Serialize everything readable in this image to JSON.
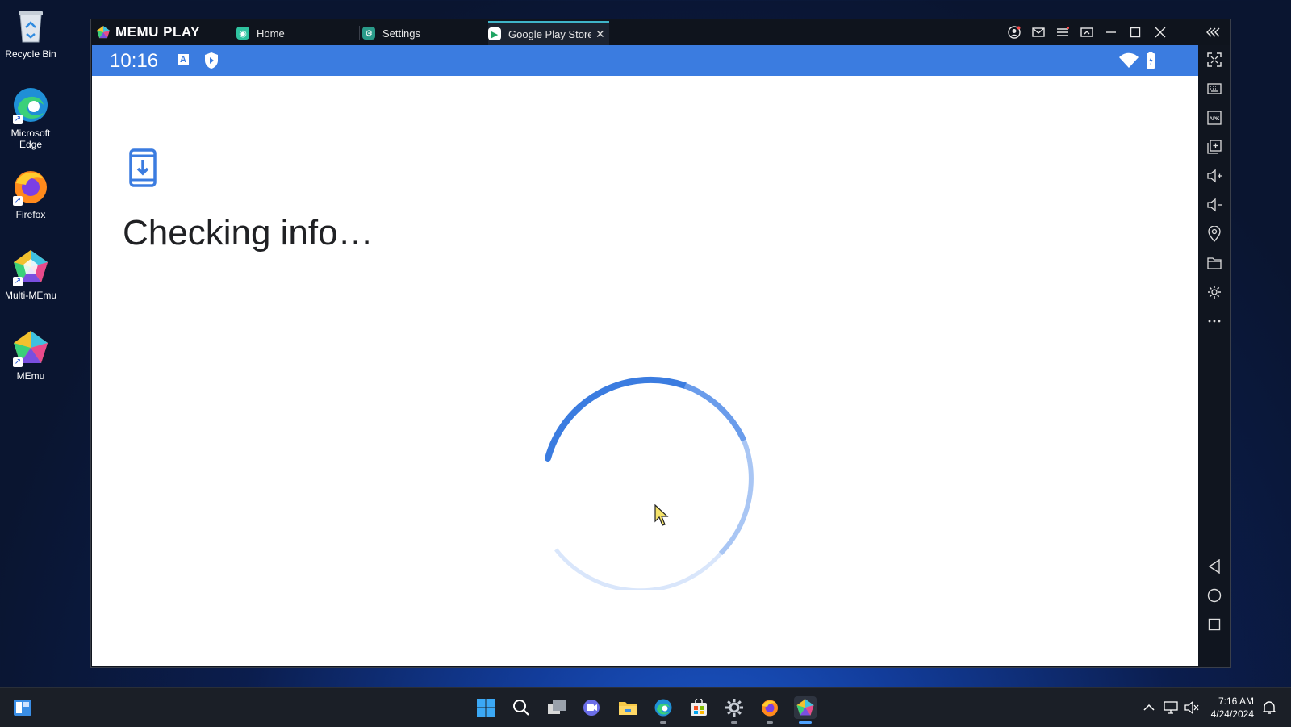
{
  "desktop": {
    "icons": [
      {
        "label": "Recycle Bin"
      },
      {
        "label": "Microsoft Edge"
      },
      {
        "label": "Firefox"
      },
      {
        "label": "Multi-MEmu"
      },
      {
        "label": "MEmu"
      }
    ]
  },
  "emulator": {
    "logo_text": "MEMU PLAY",
    "tabs": [
      {
        "label": "Home",
        "icon": "memu-home-icon"
      },
      {
        "label": "Settings",
        "icon": "gear-icon"
      },
      {
        "label": "Google Play Store",
        "icon": "play-store-icon",
        "active": true
      }
    ],
    "title_controls": [
      "account-icon",
      "mail-icon",
      "menu-icon",
      "screen-icon",
      "minimize-icon",
      "maximize-icon",
      "close-icon",
      "collapse-sidebar-icon"
    ],
    "android": {
      "status_time": "10:16",
      "status_left_icons": [
        "a-notification-icon",
        "shield-icon"
      ],
      "status_right_icons": [
        "wifi-icon",
        "battery-icon"
      ],
      "screen_title": "Checking info…",
      "screen_icon": "phone-download-icon",
      "loading": true
    },
    "side_toolbar": [
      "fullscreen-icon",
      "keyboard-icon",
      "apk-icon",
      "multi-window-icon",
      "volume-up-icon",
      "volume-down-icon",
      "location-icon",
      "folder-icon",
      "settings-icon",
      "more-icon",
      "back-icon",
      "home-icon",
      "recents-icon"
    ]
  },
  "taskbar": {
    "icons": [
      "start-icon",
      "search-icon",
      "task-view-icon",
      "meet-icon",
      "file-explorer-icon",
      "edge-icon",
      "store-icon",
      "settings-icon",
      "firefox-icon",
      "memu-icon"
    ],
    "time": "7:16 AM",
    "date": "4/24/2024",
    "tray_icons": [
      "chevron-up-icon",
      "network-icon",
      "volume-icon",
      "notification-icon"
    ]
  },
  "colors": {
    "android_statusbar": "#3b7ce0",
    "spinner": "#3b7ce0",
    "tab_accent": "#3fb5c8"
  }
}
